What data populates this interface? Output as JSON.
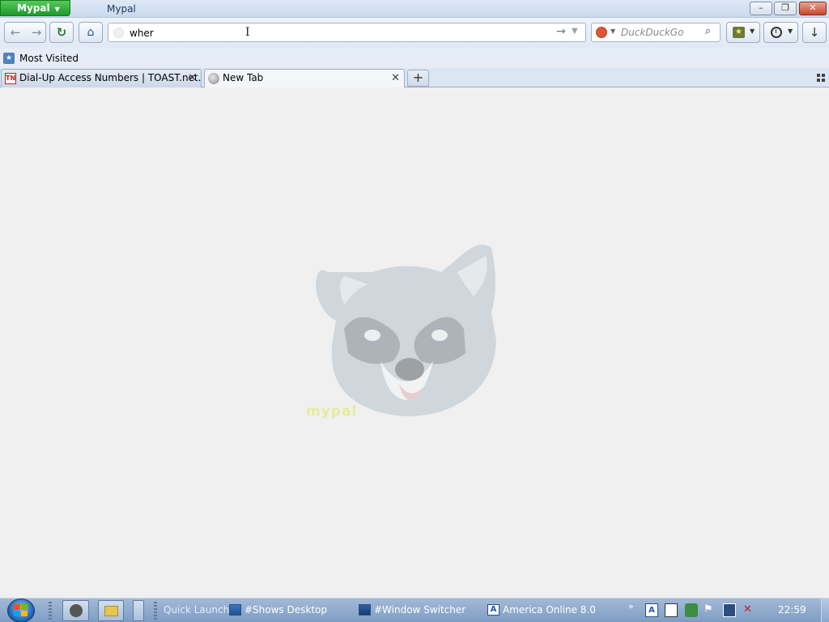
{
  "window": {
    "app_menu_label": "Mypal",
    "title": "Mypal",
    "controls": {
      "minimize": "–",
      "maximize": "❐",
      "close": "✕"
    }
  },
  "navbar": {
    "back_glyph": "←",
    "forward_glyph": "→",
    "reload_glyph": "↻",
    "home_glyph": "⌂",
    "url_value": "wher",
    "go_glyph": "→",
    "url_dropdown_glyph": "▼",
    "search": {
      "engine_icon": "duckduckgo-icon",
      "placeholder": "DuckDuckGo",
      "magnifier_glyph": "⌕"
    },
    "bookmarks_glyph": "★",
    "dropdown_glyph": "▼",
    "download_glyph": "↓"
  },
  "bookmarks_bar": {
    "items": [
      {
        "label": "Most Visited",
        "icon": "most-visited-icon",
        "icon_glyph": "★"
      }
    ]
  },
  "tabs": {
    "items": [
      {
        "label": "Dial-Up Access Numbers | TOAST.net...",
        "icon": "toast-net-favicon",
        "icon_text": "TN",
        "close": "✕",
        "active": false
      },
      {
        "label": "New Tab",
        "icon": "globe-icon",
        "close": "✕",
        "active": true
      }
    ],
    "new_tab": "+"
  },
  "content": {
    "logo_text": "mypal"
  },
  "taskbar": {
    "quick_launch_label": "Quick Launch",
    "tasks": [
      {
        "label": "#Shows Desktop",
        "icon": "desktop-icon"
      },
      {
        "label": "#Window Switcher",
        "icon": "window-switcher-icon"
      },
      {
        "label": "America Online 8.0",
        "icon": "aol-icon",
        "icon_text": "A"
      }
    ],
    "tray": {
      "chevron": "»",
      "a_icon_text": "A",
      "flag_glyph": "⚑",
      "volume_glyph": "✕"
    },
    "clock": "22:59"
  },
  "colors": {
    "accent_green": "#1d9a2b",
    "titlebar": "#c9d9ee",
    "page_background": "#f0f0f0",
    "taskbar": "#7e9cc3"
  }
}
